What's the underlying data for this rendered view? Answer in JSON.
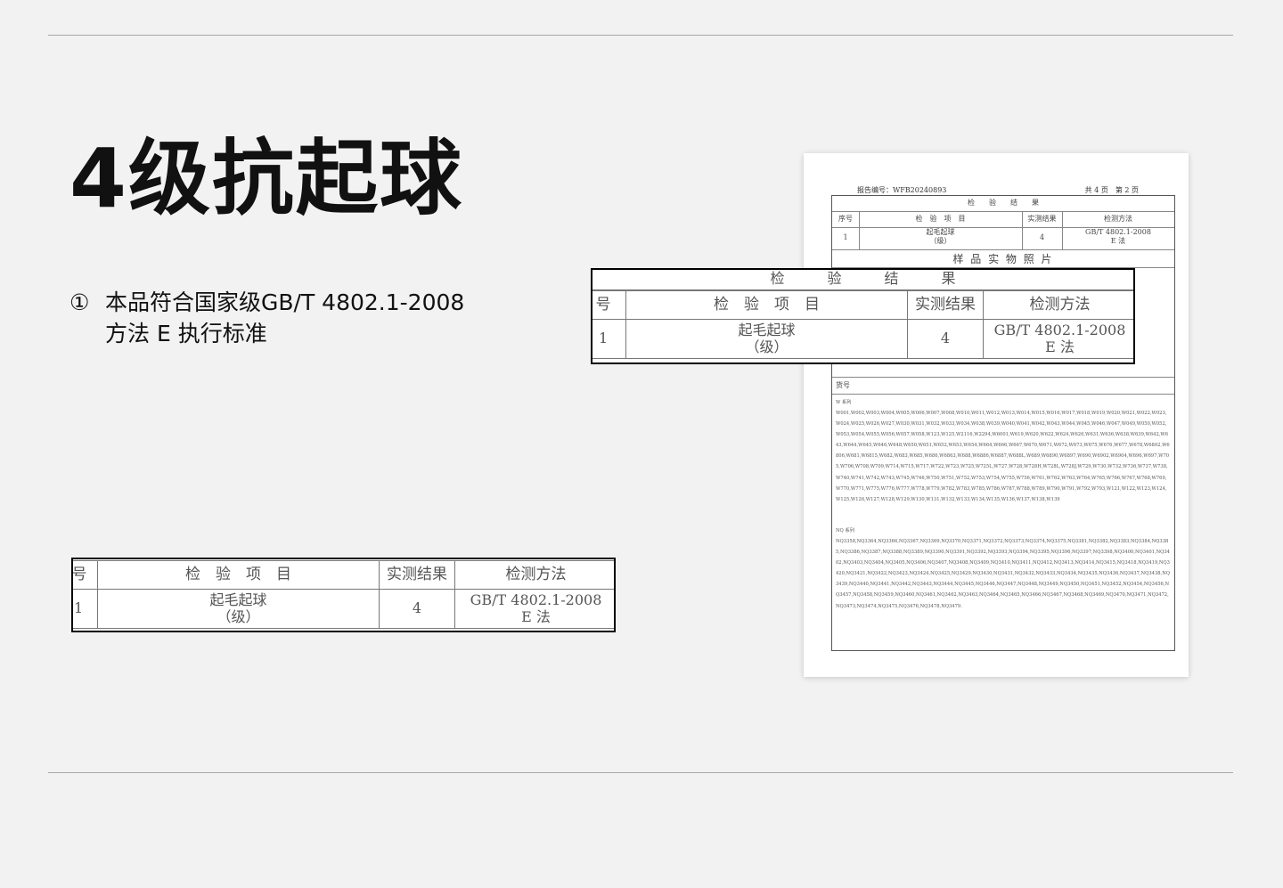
{
  "heading": "4级抗起球",
  "note": {
    "number": "①",
    "lines": [
      "本品符合国家级GB/T 4802.1-2008",
      "方法 E 执行标准"
    ]
  },
  "table": {
    "section_title": "检　　验　　结　　果",
    "headers": {
      "seq": "序号",
      "item": "检　验　项　目",
      "result": "实测结果",
      "method": "检测方法"
    },
    "row": {
      "seq": "1",
      "item_line1": "起毛起球",
      "item_line2": "（级）",
      "result": "4",
      "method_line1": "GB/T 4802.1-2008",
      "method_line2": "E 法"
    }
  },
  "crop_left": {
    "headers": {
      "seq": "号",
      "item": "检　验　项　目",
      "result": "实测结果",
      "method": "检测方法"
    },
    "row": {
      "seq": "1",
      "item_line1": "起毛起球",
      "item_line2": "（级）",
      "result": "4",
      "method_line1": "GB/T 4802.1-2008",
      "method_line2": "E 法"
    }
  },
  "crop_right": {
    "section_title": "检　　　验　　　结　　　果",
    "headers": {
      "seq": "号",
      "item": "检　验　项　目",
      "result": "实测结果",
      "method": "检测方法"
    },
    "row": {
      "seq": "1",
      "item_line1": "起毛起球",
      "item_line2": "（级）",
      "result": "4",
      "method_line1": "GB/T 4802.1-2008",
      "method_line2": "E 法"
    }
  },
  "report": {
    "report_no": "报告编号：WFB20240893",
    "pages": "共 4 页　第 2 页",
    "photo_title": "样 品 实 物 照 片",
    "goods_label": "货号",
    "w_series_label": "W 系列",
    "w_series_text": "W001,W002,W003,W004,W005,W006,W007,W008,W010,W011,W012,W013,W014,W015,W016,W017,W018,W019,W020,W021,W022,W023,W024,W025,W026,W027,W030,W031,W032,W033,W034,W038,W039,W040,W041,W042,W043,W044,W045,W046,W047,W049,W050,W052,W053,W054,W055,W056,W057,W058,W123,W125,W2116,W2294,W6001,W619,W620,W622,W624,W626,W631,W636,W638,W639,W642,W643,W644,W645,W646,W648,W650,W651,W652,W653,W654,W664,W666,W667,W670,W671,W672,W673,W675,W676,W677,W678,W6802,W6806,W681,W6815,W682,W683,W685,W686,W6863,W688,W6886,W6887,W688L,W689,W6890,W6897,W690,W6902,W6904,W696,W697,W705,W706,W708,W709,W714,W715,W717,W722,W723,W725,W725L,W727,W728,W728H,W728L,W728J,W729,W730,W732,W736,W737,W738,W740,W741,W742,W743,W745,W746,W750,W751,W752,W753,W754,W755,W756,W761,W762,W763,W764,W765,W766,W767,W768,W769,W770,W771,W775,W776,W777,W778,W779,W782,W783,W785,W786,W787,W788,W789,W790,W791,W792,W793,W121,W122,W123,W124,W125,W126,W127,W128,W129,W130,W131,W132,W133,W134,W135,W136,W137,W138,W139",
    "nq_series_label": "NQ 系列",
    "nq_series_text": "NQ3358,NQ3364,NQ3366,NQ3367,NQ3369,NQ3370,NQ3371,NQ3372,NQ3373,NQ3374,NQ3375,NQ3381,NQ3382,NQ3383,NQ3384,NQ3385,NQ3386,NQ3387,NQ3388,NQ3389,NQ3390,NQ3391,NQ3392,NQ3393,NQ3394,NQ3395,NQ3396,NQ3397,NQ3398,NQ3400,NQ3401,NQ3402,NQ3403,NQ3404,NQ3405,NQ3406,NQ3407,NQ3408,NQ3409,NQ3410,NQ3411,NQ3412,NQ3413,NQ3414,NQ3415,NQ3418,NQ3419,NQ3420,NQ3421,NQ3422,NQ3423,NQ3424,NQ3425,NQ3429,NQ3430,NQ3431,NQ3432,NQ3433,NQ3434,NQ3435,NQ3436,NQ3437,NQ3438,NQ3439,NQ3440,NQ3441,NQ3442,NQ3443,NQ3444,NQ3445,NQ3446,NQ3447,NQ3448,NQ3449,NQ3450,NQ3451,NQ3452,NQ3454,NQ3456,NQ3457,NQ3458,NQ3459,NQ3460,NQ3461,NQ3462,NQ3463,NQ3464,NQ3465,NQ3466,NQ3467,NQ3468,NQ3469,NQ3470,NQ3471,NQ3472,NQ3473,NQ3474,NQ3475,NQ3476,NQ3478,NQ3479."
  }
}
